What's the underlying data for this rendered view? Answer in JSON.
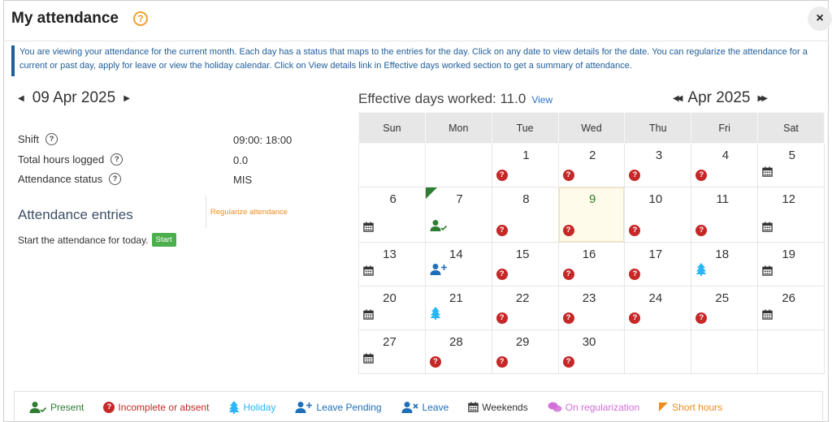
{
  "header": {
    "title": "My attendance",
    "help_symbol": "?",
    "close_symbol": "×"
  },
  "info_text": "You are viewing your attendance for the current month. Each day has a status that maps to the entries for the day. Click on any date to view details for the date. You can regularize the attendance for a current or past day, apply for leave or view the holiday calendar. Click on View details link in Effective days worked section to get a summary of attendance.",
  "day_panel": {
    "date": "09 Apr 2025",
    "shift_label": "Shift",
    "shift_value": "09:00: 18:00",
    "hours_label": "Total hours logged",
    "hours_value": "0.0",
    "status_label": "Attendance status",
    "status_value": "MIS",
    "entries_title": "Attendance entries",
    "regularize_link": "Regularize attendance",
    "start_text": "Start the attendance for today.",
    "start_button": "Start"
  },
  "effective": {
    "label": "Effective days worked: 11.0",
    "view_link": "View"
  },
  "calendar": {
    "month_label": "Apr 2025",
    "weekdays": [
      "Sun",
      "Mon",
      "Tue",
      "Wed",
      "Thu",
      "Fri",
      "Sat"
    ],
    "weeks": [
      [
        "",
        "",
        "1",
        "2",
        "3",
        "4",
        "5"
      ],
      [
        "6",
        "7",
        "8",
        "9",
        "10",
        "11",
        "12"
      ],
      [
        "13",
        "14",
        "15",
        "16",
        "17",
        "18",
        "19"
      ],
      [
        "20",
        "21",
        "22",
        "23",
        "24",
        "25",
        "26"
      ],
      [
        "27",
        "28",
        "29",
        "30",
        "",
        "",
        ""
      ]
    ],
    "status_icons": {
      "weekend": "calendar-icon",
      "incomplete": "red-question-icon",
      "present": "user-check-icon",
      "leave_pending": "user-plus-icon",
      "holiday": "tree-icon"
    }
  },
  "legend": [
    {
      "label": "Present",
      "icon": "user-check-icon",
      "color": "#2e7d32"
    },
    {
      "label": "Incomplete or absent",
      "icon": "red-question-icon",
      "color": "#c62828"
    },
    {
      "label": "Holiday",
      "icon": "tree-icon",
      "color": "#29b6f6"
    },
    {
      "label": "Leave Pending",
      "icon": "user-plus-icon",
      "color": "#1e6fb8"
    },
    {
      "label": "Leave",
      "icon": "user-x-icon",
      "color": "#1e6fb8"
    },
    {
      "label": "Weekends",
      "icon": "calendar-icon",
      "color": "#333333"
    },
    {
      "label": "On regularization",
      "icon": "chat-icon",
      "color": "#d36fd8"
    },
    {
      "label": "Short hours",
      "icon": "short-hours-icon",
      "color": "#f08c1e"
    }
  ]
}
